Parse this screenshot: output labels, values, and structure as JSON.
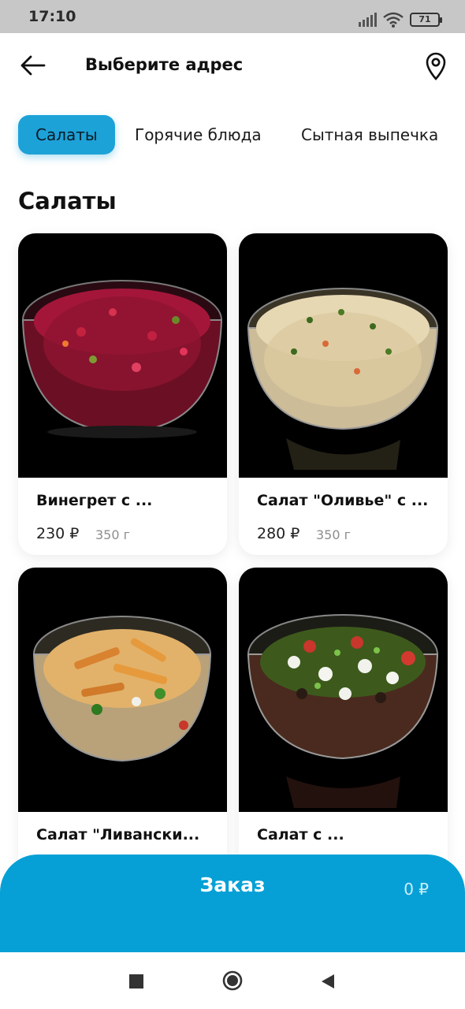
{
  "status_bar": {
    "time": "17:10",
    "battery": "71"
  },
  "header": {
    "title": "Выберите адрес"
  },
  "tabs": [
    {
      "label": "Салаты"
    },
    {
      "label": "Горячие блюда"
    },
    {
      "label": "Сытная выпечка"
    }
  ],
  "section": {
    "title": "Салаты"
  },
  "products": [
    {
      "name": "Винегрет с ...",
      "price": "230 ₽",
      "weight": "350 г"
    },
    {
      "name": "Салат \"Оливье\" с ...",
      "price": "280 ₽",
      "weight": "350 г"
    },
    {
      "name": "Салат \"Ливански...",
      "price": "",
      "weight": ""
    },
    {
      "name": "Салат с ...",
      "price": "",
      "weight": ""
    }
  ],
  "order_bar": {
    "label": "Заказ",
    "total": "0 ₽"
  },
  "colors": {
    "accent": "#06a0d6",
    "tab_active": "#1da2d8"
  },
  "icons": [
    "back-arrow-icon",
    "location-pin-icon",
    "signal-icon",
    "wifi-icon",
    "battery-icon",
    "square-nav-icon",
    "circle-nav-icon",
    "triangle-nav-icon"
  ]
}
